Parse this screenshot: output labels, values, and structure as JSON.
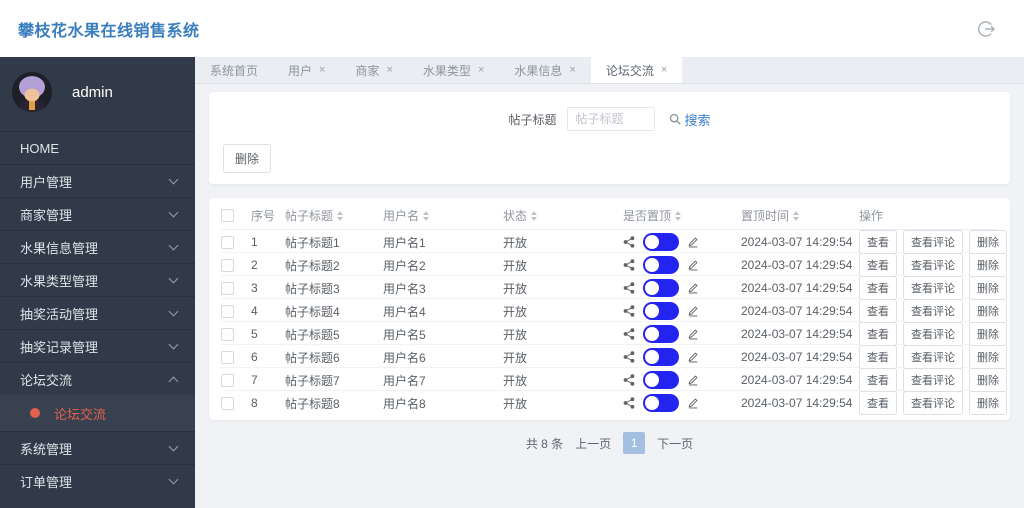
{
  "app": {
    "title": "攀枝花水果在线销售系统"
  },
  "sidebar": {
    "username": "admin",
    "items": [
      {
        "label": "HOME",
        "expandable": false
      },
      {
        "label": "用户管理",
        "expandable": true
      },
      {
        "label": "商家管理",
        "expandable": true
      },
      {
        "label": "水果信息管理",
        "expandable": true
      },
      {
        "label": "水果类型管理",
        "expandable": true
      },
      {
        "label": "抽奖活动管理",
        "expandable": true
      },
      {
        "label": "抽奖记录管理",
        "expandable": true
      },
      {
        "label": "论坛交流",
        "expandable": true,
        "expanded": true,
        "children": [
          {
            "label": "论坛交流",
            "active": true
          }
        ]
      },
      {
        "label": "系统管理",
        "expandable": true
      },
      {
        "label": "订单管理",
        "expandable": true
      }
    ]
  },
  "tabs": [
    {
      "label": "系统首页",
      "closable": false,
      "active": false
    },
    {
      "label": "用户",
      "closable": true,
      "active": false
    },
    {
      "label": "商家",
      "closable": true,
      "active": false
    },
    {
      "label": "水果类型",
      "closable": true,
      "active": false
    },
    {
      "label": "水果信息",
      "closable": true,
      "active": false
    },
    {
      "label": "论坛交流",
      "closable": true,
      "active": true
    }
  ],
  "search": {
    "label": "帖子标题",
    "placeholder": "帖子标题",
    "button": "搜索"
  },
  "toolbar": {
    "delete_label": "删除"
  },
  "table": {
    "columns": [
      {
        "label": "序号",
        "sortable": false
      },
      {
        "label": "帖子标题",
        "sortable": true
      },
      {
        "label": "用户名",
        "sortable": true
      },
      {
        "label": "状态",
        "sortable": true
      },
      {
        "label": "是否置顶",
        "sortable": true
      },
      {
        "label": "置顶时间",
        "sortable": true
      },
      {
        "label": "操作",
        "sortable": false
      }
    ],
    "rows": [
      {
        "index": "1",
        "title": "帖子标题1",
        "user": "用户名1",
        "status": "开放",
        "pinned": true,
        "pinned_time": "2024-03-07 14:29:54"
      },
      {
        "index": "2",
        "title": "帖子标题2",
        "user": "用户名2",
        "status": "开放",
        "pinned": true,
        "pinned_time": "2024-03-07 14:29:54"
      },
      {
        "index": "3",
        "title": "帖子标题3",
        "user": "用户名3",
        "status": "开放",
        "pinned": true,
        "pinned_time": "2024-03-07 14:29:54"
      },
      {
        "index": "4",
        "title": "帖子标题4",
        "user": "用户名4",
        "status": "开放",
        "pinned": true,
        "pinned_time": "2024-03-07 14:29:54"
      },
      {
        "index": "5",
        "title": "帖子标题5",
        "user": "用户名5",
        "status": "开放",
        "pinned": true,
        "pinned_time": "2024-03-07 14:29:54"
      },
      {
        "index": "6",
        "title": "帖子标题6",
        "user": "用户名6",
        "status": "开放",
        "pinned": true,
        "pinned_time": "2024-03-07 14:29:54"
      },
      {
        "index": "7",
        "title": "帖子标题7",
        "user": "用户名7",
        "status": "开放",
        "pinned": true,
        "pinned_time": "2024-03-07 14:29:54"
      },
      {
        "index": "8",
        "title": "帖子标题8",
        "user": "用户名8",
        "status": "开放",
        "pinned": true,
        "pinned_time": "2024-03-07 14:29:54"
      }
    ],
    "actions": [
      {
        "label": "查看",
        "name": "view-button"
      },
      {
        "label": "查看评论",
        "name": "view-comments-button"
      },
      {
        "label": "删除",
        "name": "delete-row-button"
      }
    ]
  },
  "pagination": {
    "total": "共 8 条",
    "prev": "上一页",
    "page": "1",
    "next": "下一页"
  },
  "colors": {
    "accent_blue": "#3e7fd0",
    "toggle_blue": "#2424f0",
    "active_red": "#e2604e",
    "sidebar_bg": "#303a48",
    "title_blue": "#3a7ebf",
    "page_bg": "#f0f2f5",
    "pagination_active_bg": "#a3c0e0"
  }
}
